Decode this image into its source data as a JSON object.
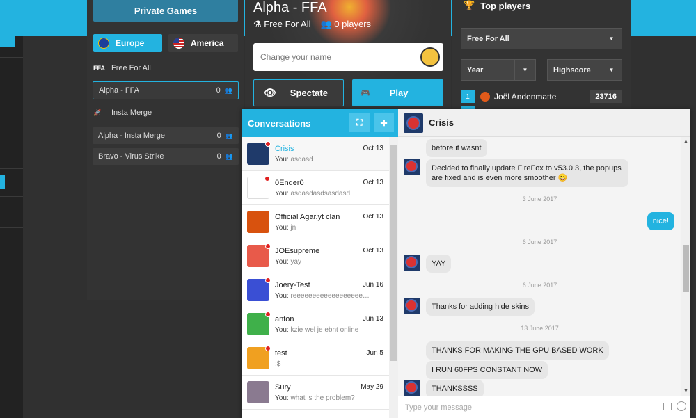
{
  "servers": {
    "private_games_label": "Private Games",
    "regions": [
      {
        "label": "Europe",
        "icon": "eu-flag-icon"
      },
      {
        "label": "America",
        "icon": "us-flag-icon"
      }
    ],
    "modes": [
      {
        "abbr": "FFA",
        "label": "Free For All",
        "rooms": [
          {
            "name": "Alpha - FFA",
            "players": "0"
          }
        ]
      },
      {
        "abbr": "",
        "label": "Insta Merge",
        "rooms": [
          {
            "name": "Alpha - Insta Merge",
            "players": "0"
          },
          {
            "name": "Bravo - Virus Strike",
            "players": "0"
          }
        ]
      }
    ]
  },
  "center": {
    "title": "Alpha - FFA",
    "mode": "Free For All",
    "players": "0 players",
    "name_placeholder": "Change your name",
    "spectate_label": "Spectate",
    "play_label": "Play"
  },
  "top_players": {
    "title": "Top players",
    "mode_select": "Free For All",
    "period_select": "Year",
    "metric_select": "Highscore",
    "entries": [
      {
        "rank": "1",
        "name": "Joël Andenmatte",
        "score": "23716"
      }
    ]
  },
  "conversations": {
    "title": "Conversations",
    "items": [
      {
        "name": "Crisis",
        "date": "Oct 13",
        "you": "You:",
        "preview": "asdasd",
        "color": "#1f3a6a",
        "dot": true
      },
      {
        "name": "0Ender0",
        "date": "Oct 13",
        "you": "You:",
        "preview": "asdasdasdsasdasd",
        "color": "#ffffff",
        "dot": true
      },
      {
        "name": "Official Agar.yt clan",
        "date": "Oct 13",
        "you": "You:",
        "preview": "jn",
        "color": "#d8520e",
        "dot": false
      },
      {
        "name": "JOEsupreme",
        "date": "Oct 13",
        "you": "You:",
        "preview": "yay",
        "color": "#e85a4a",
        "dot": true
      },
      {
        "name": "Joery-Test",
        "date": "Jun 16",
        "you": "You:",
        "preview": "reeeeeeeeeeeeeeeeeeeeeeeeeeeeeee",
        "color": "#3a4fd4",
        "dot": true
      },
      {
        "name": "anton",
        "date": "Jun 13",
        "you": "You:",
        "preview": "kzie wel je ebnt online",
        "color": "#3fb04a",
        "dot": true
      },
      {
        "name": "test",
        "date": "Jun 5",
        "you": "",
        "preview": ":$",
        "color": "#f0a020",
        "dot": true
      },
      {
        "name": "Sury",
        "date": "May 29",
        "you": "You:",
        "preview": "what is the problem?",
        "color": "#8a7a90",
        "dot": false
      }
    ]
  },
  "chat": {
    "contact": "Crisis",
    "messages": [
      {
        "text": "before it wasnt"
      },
      {
        "text": "Decided to finally update FireFox to v53.0.3, the popups are fixed and is even more smoother 😀"
      },
      {
        "text": "3 June 2017"
      },
      {
        "text": "nice!"
      },
      {
        "text": "6 June 2017"
      },
      {
        "text": "YAY"
      },
      {
        "text": "6 June 2017"
      },
      {
        "text": "Thanks for adding hide skins"
      },
      {
        "text": "13 June 2017"
      },
      {
        "text": "THANKS FOR MAKING THE GPU BASED WORK"
      },
      {
        "text": "I RUN 60FPS CONSTANT NOW"
      },
      {
        "text": "THANKSSSS"
      }
    ],
    "input_placeholder": "Type your message"
  }
}
